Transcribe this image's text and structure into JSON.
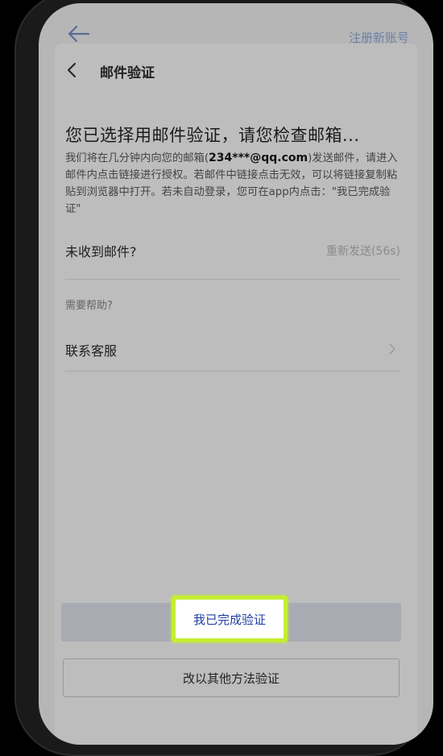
{
  "background": {
    "register_link": "注册新账号"
  },
  "sheet": {
    "title": "邮件验证",
    "heading": "您已选择用邮件验证，请您检查邮箱...",
    "description": {
      "before_email": "我们将在几分钟内向您的邮箱(",
      "email": "234***@qq.com",
      "after_email": ")发送邮件，请进入邮件内点击链接进行授权。若邮件中链接点击无效，可以将链接复制粘贴到浏览器中打开。若未自动登录，您可在app内点击：\"我已完成验证\""
    },
    "not_received_label": "未收到邮件?",
    "resend_label": "重新发送(56s)",
    "help_label": "需要帮助?",
    "contact_support_label": "联系客服",
    "primary_button": "我已完成验证",
    "secondary_button": "改以其他方法验证"
  },
  "colors": {
    "highlight": "#c6ed34",
    "primary_text": "#1f3fa0"
  }
}
